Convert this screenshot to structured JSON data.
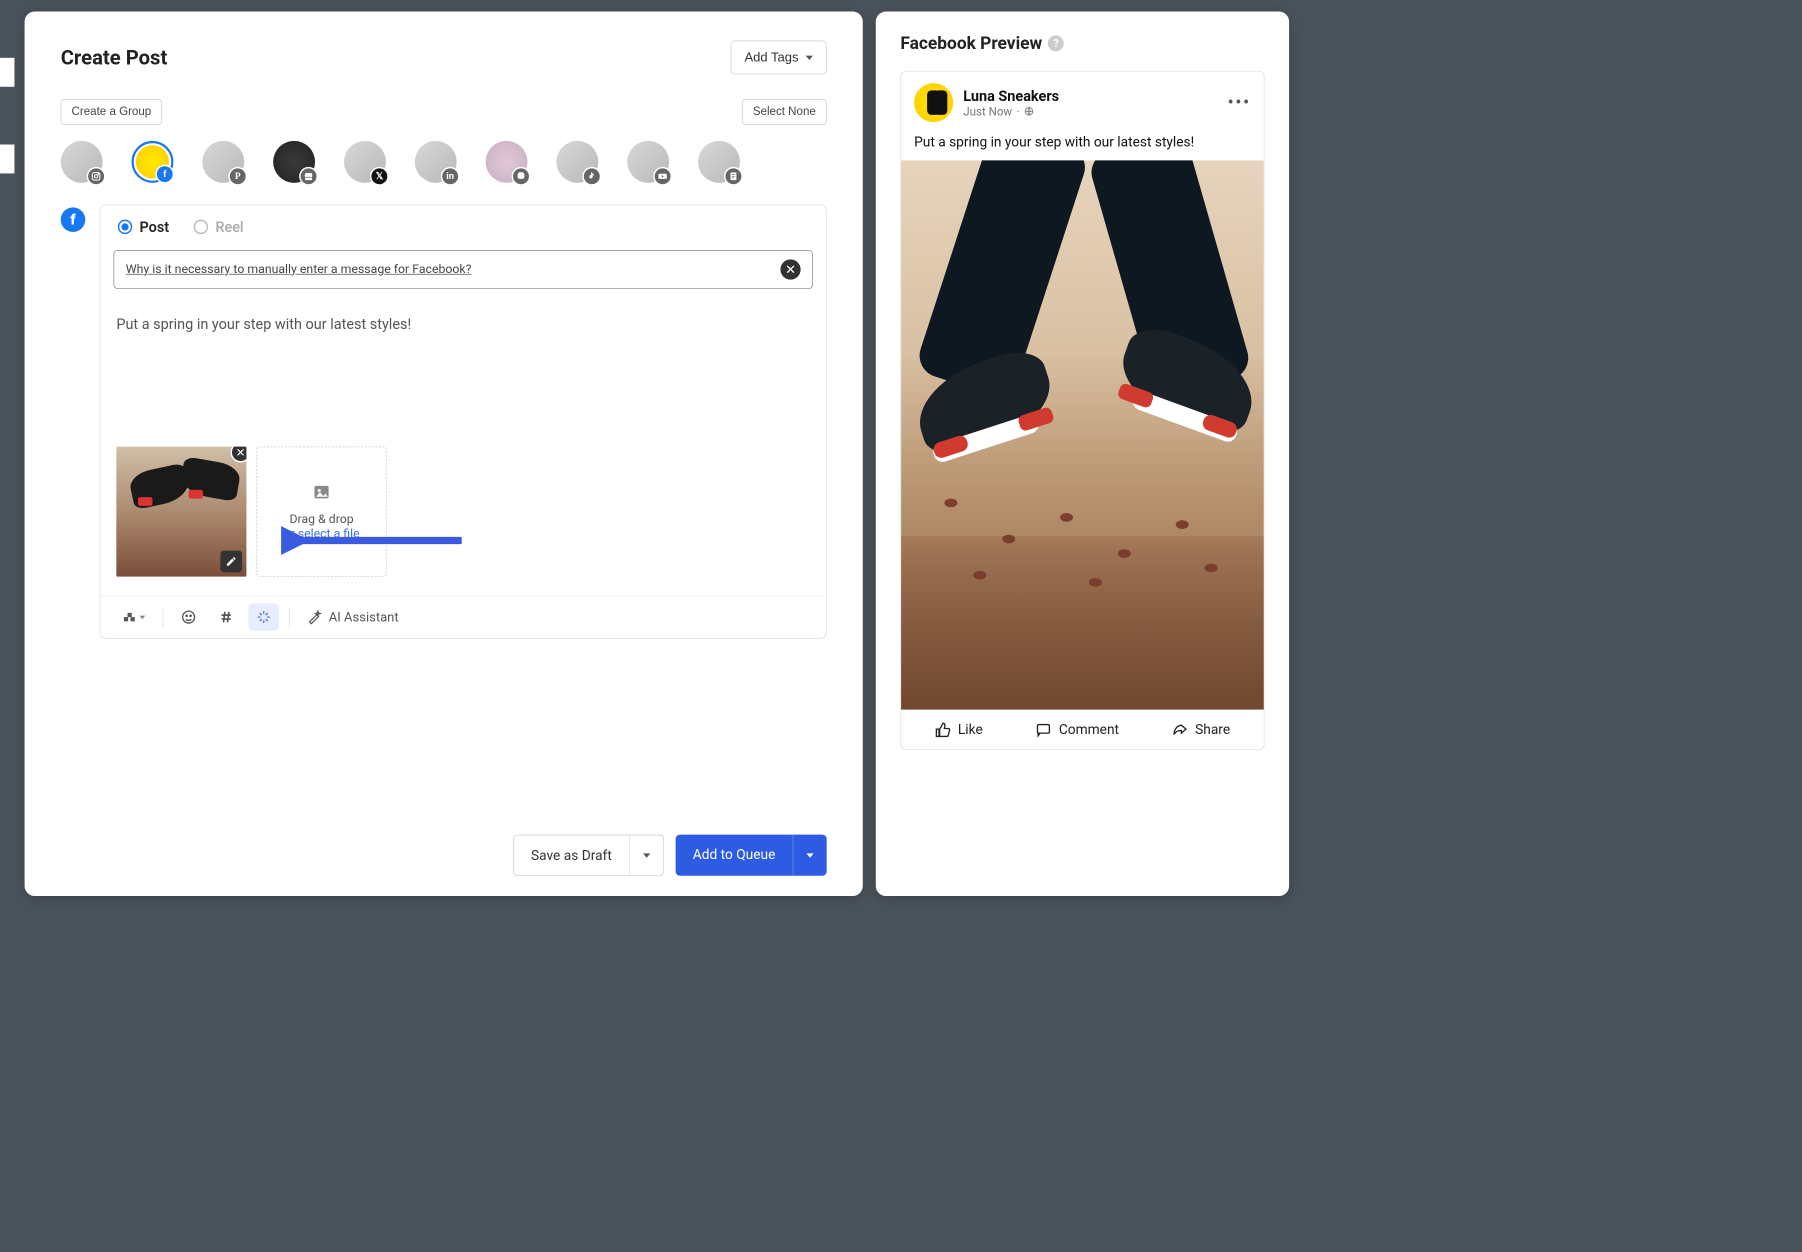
{
  "header": {
    "title": "Create Post",
    "add_tags_label": "Add Tags"
  },
  "group_row": {
    "create_group_label": "Create a Group",
    "select_none_label": "Select None"
  },
  "accounts": [
    {
      "network": "instagram",
      "selected": false
    },
    {
      "network": "facebook",
      "selected": true
    },
    {
      "network": "pinterest",
      "selected": false
    },
    {
      "network": "gmb",
      "selected": false
    },
    {
      "network": "x",
      "selected": false
    },
    {
      "network": "linkedin",
      "selected": false
    },
    {
      "network": "mastodon",
      "selected": false
    },
    {
      "network": "tiktok",
      "selected": false
    },
    {
      "network": "youtube",
      "selected": false
    },
    {
      "network": "blog",
      "selected": false
    }
  ],
  "composer": {
    "tabs": {
      "post_label": "Post",
      "reel_label": "Reel",
      "active": "post"
    },
    "info_banner": "Why is it necessary to manually enter a message for Facebook?",
    "message": "Put a spring in your step with our latest styles!",
    "dropzone": {
      "line1": "Drag & drop",
      "line2_prefix": "or ",
      "link_text": "select a file"
    },
    "toolbar": {
      "ai_label": "AI Assistant"
    }
  },
  "footer": {
    "save_draft_label": "Save as Draft",
    "add_queue_label": "Add to Queue"
  },
  "preview": {
    "panel_title": "Facebook Preview",
    "account_name": "Luna Sneakers",
    "timestamp": "Just Now",
    "message": "Put a spring in your step with our latest styles!",
    "actions": {
      "like": "Like",
      "comment": "Comment",
      "share": "Share"
    }
  }
}
